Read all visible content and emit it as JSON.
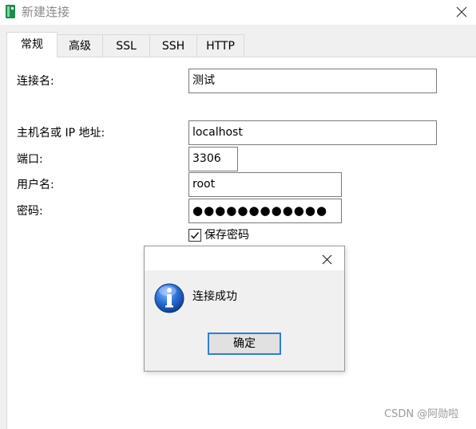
{
  "window": {
    "title": "新建连接",
    "icon": "navicat-app-icon",
    "close_icon": "close-icon"
  },
  "tabs": [
    {
      "label": "常规",
      "active": true
    },
    {
      "label": "高级",
      "active": false
    },
    {
      "label": "SSL",
      "active": false
    },
    {
      "label": "SSH",
      "active": false
    },
    {
      "label": "HTTP",
      "active": false
    }
  ],
  "form": {
    "connection_name": {
      "label": "连接名:",
      "value": "测试"
    },
    "host": {
      "label": "主机名或 IP 地址:",
      "value": "localhost"
    },
    "port": {
      "label": "端口:",
      "value": "3306"
    },
    "username": {
      "label": "用户名:",
      "value": "root"
    },
    "password": {
      "label": "密码:",
      "value": "●●●●●●●●●●●●"
    },
    "save_password": {
      "label": "保存密码",
      "checked": true
    }
  },
  "dialog": {
    "message": "连接成功",
    "ok_label": "确定",
    "icon": "info-icon"
  },
  "watermark": "CSDN @阿勋啦",
  "colors": {
    "accent": "#2f7fd0",
    "app_icon_green": "#1e8c4e",
    "info_blue": "#1f5fbf"
  }
}
